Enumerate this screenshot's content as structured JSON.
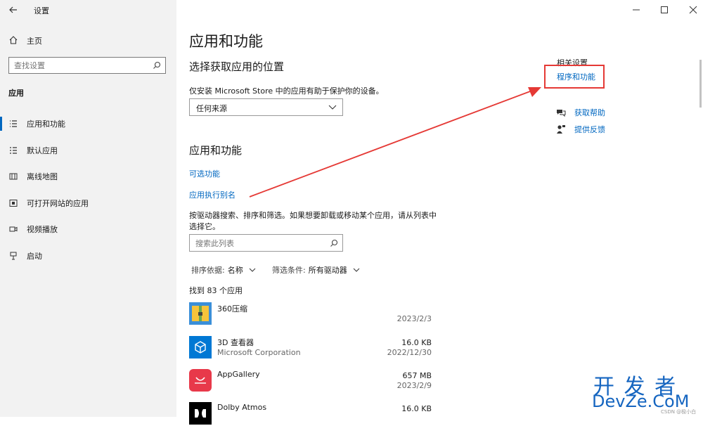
{
  "titlebar": {
    "back_icon": "back-arrow-icon",
    "title": "设置",
    "min_icon": "minimize-icon",
    "max_icon": "maximize-icon",
    "close_icon": "close-icon"
  },
  "sidebar": {
    "home_label": "主页",
    "search_placeholder": "查找设置",
    "section_title": "应用",
    "items": [
      {
        "label": "应用和功能",
        "icon": "list-icon",
        "active": true
      },
      {
        "label": "默认应用",
        "icon": "default-apps-icon"
      },
      {
        "label": "离线地图",
        "icon": "map-icon"
      },
      {
        "label": "可打开网站的应用",
        "icon": "website-app-icon"
      },
      {
        "label": "视频播放",
        "icon": "video-icon"
      },
      {
        "label": "启动",
        "icon": "startup-icon"
      }
    ]
  },
  "main": {
    "page_title": "应用和功能",
    "source_section_title": "选择获取应用的位置",
    "source_desc": "仅安装 Microsoft Store 中的应用有助于保护你的设备。",
    "source_select_value": "任何来源",
    "apps_section_title": "应用和功能",
    "link_optional": "可选功能",
    "link_alias": "应用执行别名",
    "search_desc": "按驱动器搜索、排序和筛选。如果想要卸载或移动某个应用，请从列表中选择它。",
    "search_placeholder": "搜索此列表",
    "sort_label": "排序依据:",
    "sort_value": "名称",
    "filter_label": "筛选条件:",
    "filter_value": "所有驱动器",
    "found_count": "找到 83 个应用",
    "apps": [
      {
        "name": "360压缩",
        "publisher": "",
        "size": "",
        "date": "2023/2/3",
        "icon": "360zip-icon"
      },
      {
        "name": "3D 查看器",
        "publisher": "Microsoft Corporation",
        "size": "16.0 KB",
        "date": "2022/12/30",
        "icon": "3d-viewer-icon"
      },
      {
        "name": "AppGallery",
        "publisher": "",
        "size": "657 MB",
        "date": "2023/2/9",
        "icon": "appgallery-icon"
      },
      {
        "name": "Dolby Atmos",
        "publisher": "",
        "size": "16.0 KB",
        "date": "",
        "icon": "dolby-icon"
      }
    ]
  },
  "related": {
    "title": "相关设置",
    "programs_link": "程序和功能",
    "help_label": "获取帮助",
    "feedback_label": "提供反馈"
  },
  "watermark": {
    "line1": "开 发 者",
    "line2": "DevZe.CoM",
    "small": "CSDN @极小白"
  },
  "colors": {
    "accent": "#0067c0",
    "annotation_red": "#e53935"
  }
}
